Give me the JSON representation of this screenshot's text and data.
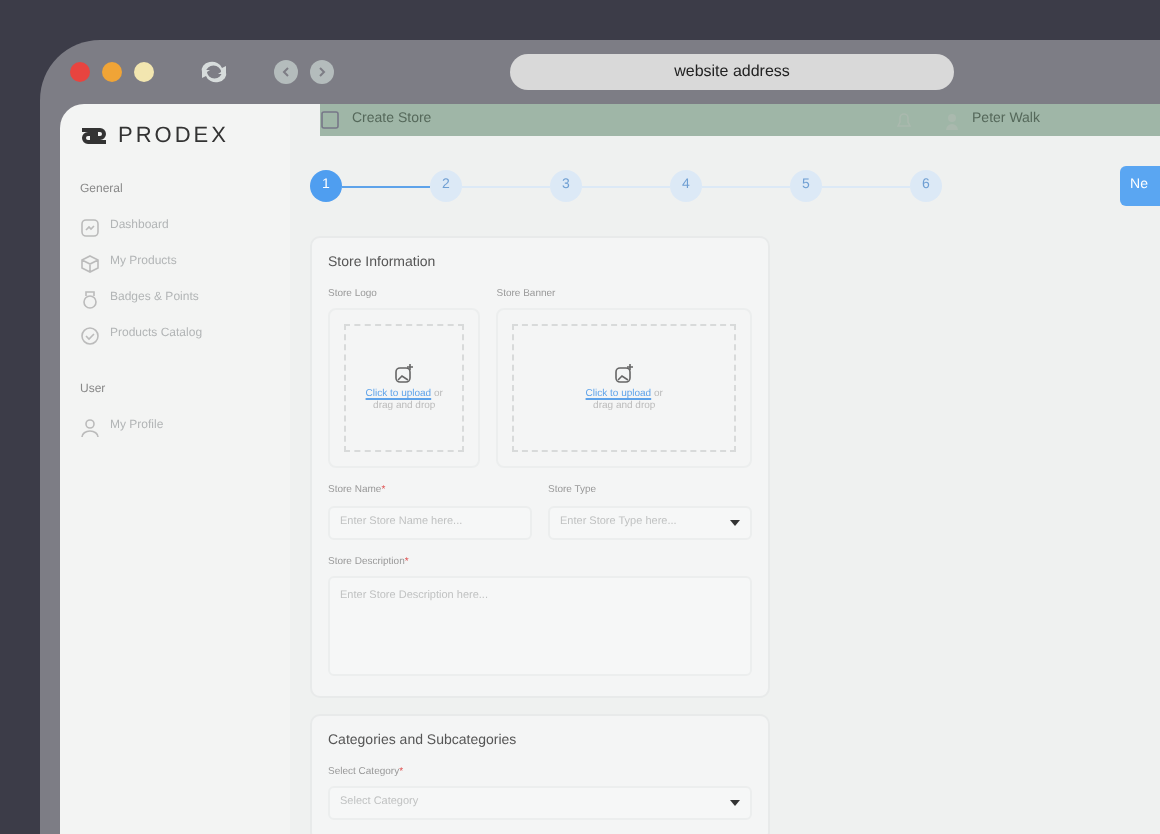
{
  "browser": {
    "address": "website address"
  },
  "sidebar": {
    "logo": "PRODEX",
    "sections": [
      {
        "title": "General",
        "items": [
          {
            "label": "Dashboard"
          },
          {
            "label": "My Products"
          },
          {
            "label": "Badges & Points"
          },
          {
            "label": "Products Catalog"
          }
        ]
      },
      {
        "title": "User",
        "items": [
          {
            "label": "My Profile"
          }
        ]
      }
    ]
  },
  "header": {
    "title": "Create Store",
    "user": "Peter Walk"
  },
  "steps": [
    {
      "label": "1",
      "selected": true
    },
    {
      "label": "2",
      "selected": false
    },
    {
      "label": "3",
      "selected": false
    },
    {
      "label": "4",
      "selected": false
    },
    {
      "label": "5",
      "selected": false
    },
    {
      "label": "6",
      "selected": false
    }
  ],
  "next_button": "Ne",
  "store_info": {
    "title": "Store Information",
    "uploads": [
      {
        "label": "Store Logo",
        "link": "Click to upload",
        "rest": "or",
        "line2": "drag and drop"
      },
      {
        "label": "Store Banner",
        "link": "Click to upload",
        "rest": "or",
        "line2": "drag and drop"
      }
    ],
    "fields": [
      {
        "label": "Store Name",
        "asterisk": "*",
        "kind": "text",
        "placeholder": "Enter Store Name here..."
      },
      {
        "label": "Store Type",
        "kind": "select",
        "placeholder": "Enter Store Type here..."
      },
      {
        "label": "Store Description",
        "asterisk": "*",
        "kind": "textarea",
        "placeholder": "Enter Store Description here..."
      }
    ]
  },
  "categories": {
    "title": "Categories and Subcategories",
    "fields": [
      {
        "label": "Select Category",
        "asterisk": "*",
        "kind": "select",
        "placeholder": "Select Category"
      }
    ]
  }
}
